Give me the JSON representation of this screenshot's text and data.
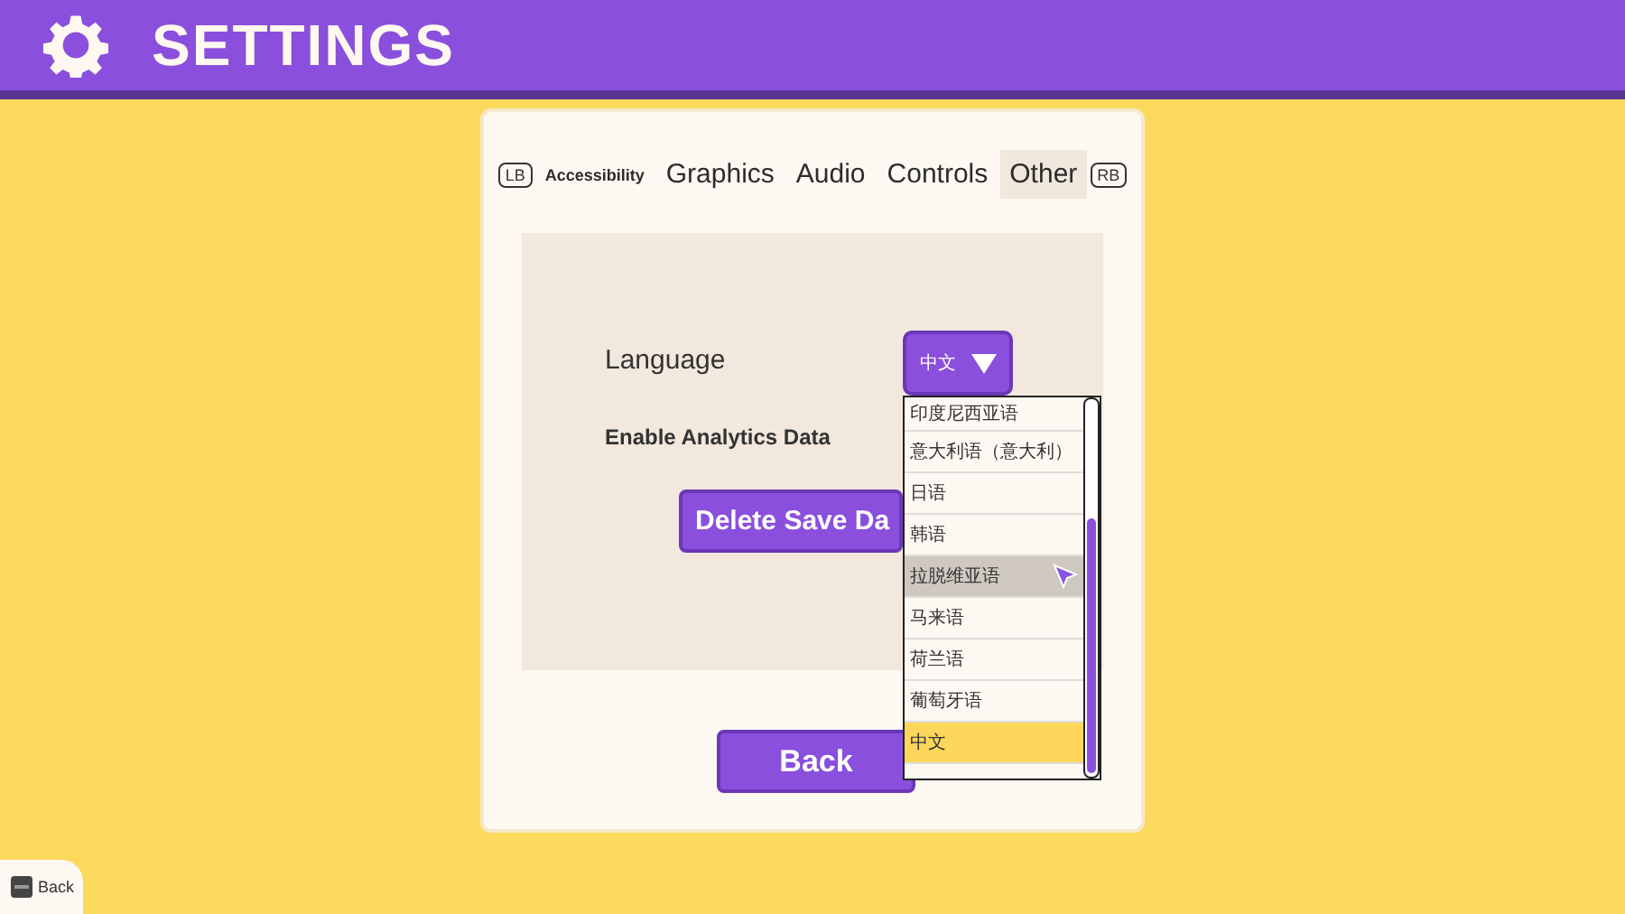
{
  "header": {
    "title": "SETTINGS"
  },
  "tabs": {
    "left_hint": "LB",
    "right_hint": "RB",
    "items": [
      {
        "label": "Accessibility",
        "selected": false,
        "kind": "small"
      },
      {
        "label": "Graphics",
        "selected": false,
        "kind": "normal"
      },
      {
        "label": "Audio",
        "selected": false,
        "kind": "normal"
      },
      {
        "label": "Controls",
        "selected": false,
        "kind": "normal"
      },
      {
        "label": "Other",
        "selected": true,
        "kind": "normal"
      }
    ]
  },
  "settings": {
    "language_label": "Language",
    "analytics_label": "Enable Analytics Data",
    "delete_button": "Delete Save Da"
  },
  "language_dropdown": {
    "value": "中文",
    "expanded": true,
    "options": [
      {
        "label": "印度尼西亚语",
        "selected": false,
        "hovered": false
      },
      {
        "label": "意大利语（意大利）",
        "selected": false,
        "hovered": false
      },
      {
        "label": "日语",
        "selected": false,
        "hovered": false
      },
      {
        "label": "韩语",
        "selected": false,
        "hovered": false
      },
      {
        "label": "拉脱维亚语",
        "selected": false,
        "hovered": true
      },
      {
        "label": "马来语",
        "selected": false,
        "hovered": false
      },
      {
        "label": "荷兰语",
        "selected": false,
        "hovered": false
      },
      {
        "label": "葡萄牙语",
        "selected": false,
        "hovered": false
      },
      {
        "label": "中文",
        "selected": true,
        "hovered": false
      }
    ]
  },
  "back_button": "Back",
  "footer": {
    "back_hint": "Back"
  }
}
